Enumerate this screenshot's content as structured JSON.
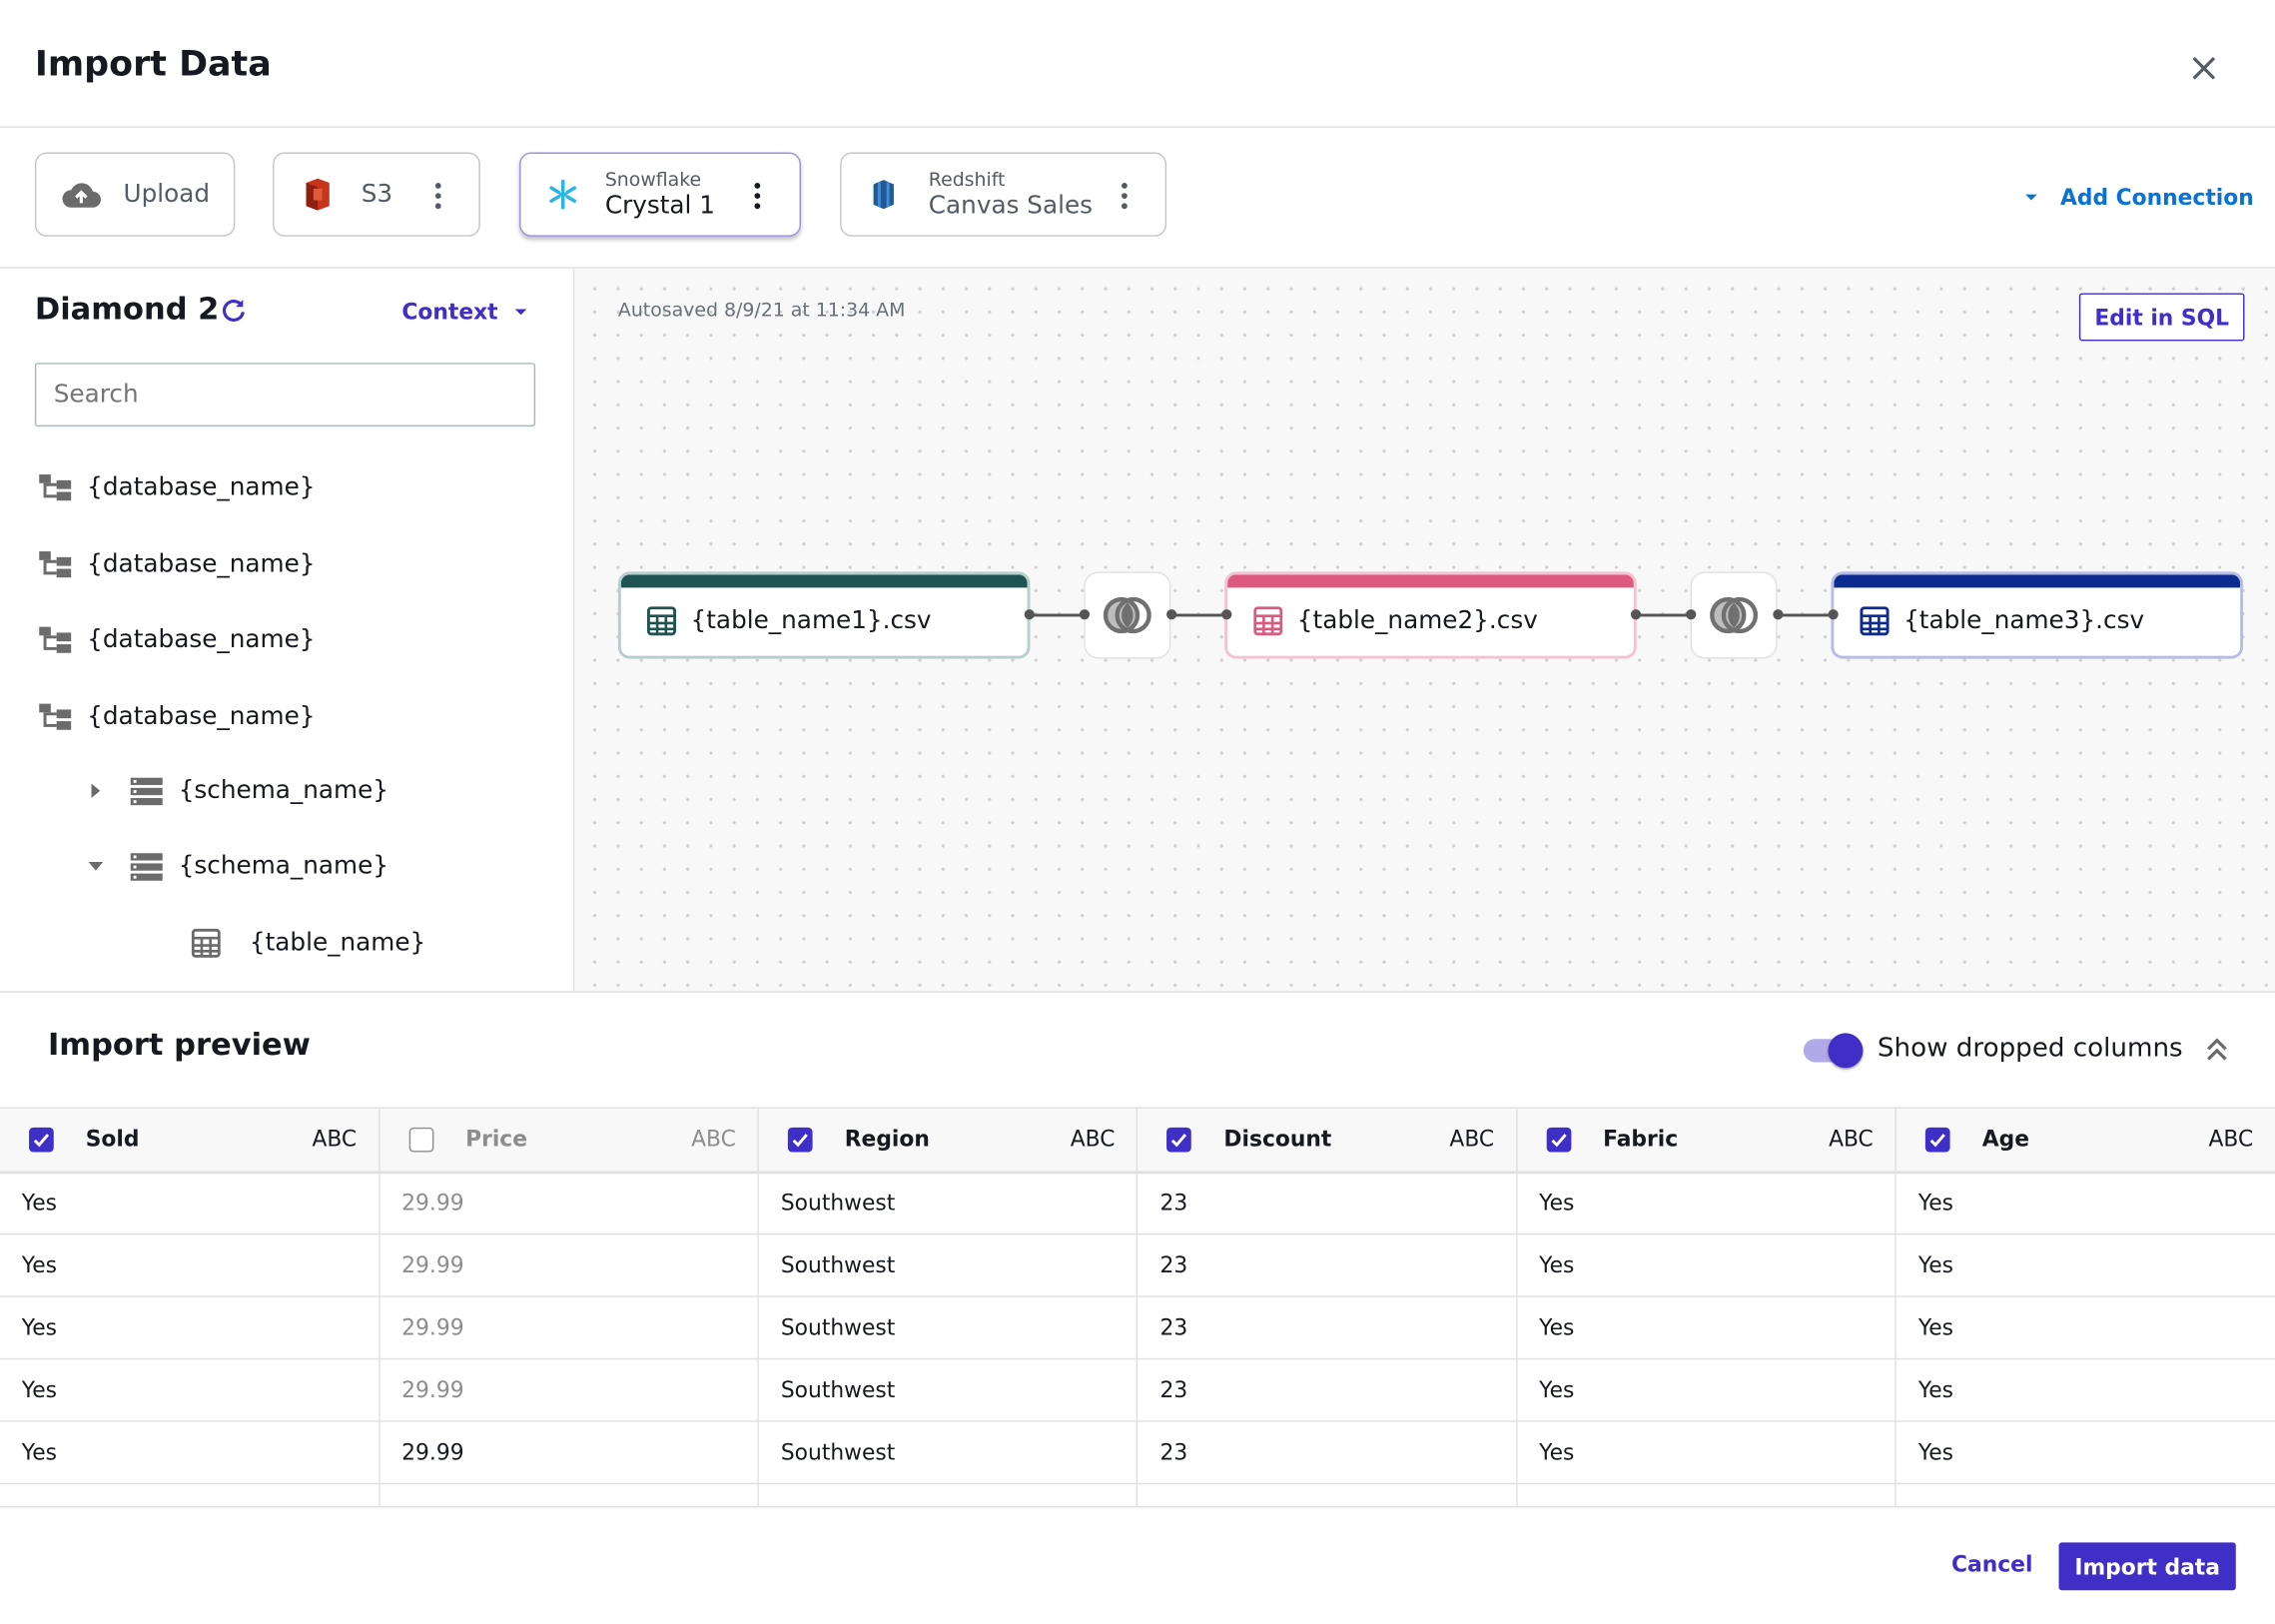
{
  "header": {
    "title": "Import Data",
    "close_icon": "close-icon"
  },
  "connections": {
    "items": [
      {
        "label": "Upload",
        "icon": "cloud-upload-icon"
      },
      {
        "label": "S3",
        "icon": "s3-icon"
      },
      {
        "type": "Snowflake",
        "label": "Crystal 1",
        "icon": "snowflake-icon",
        "selected": true
      },
      {
        "type": "Redshift",
        "label": "Canvas Sales",
        "icon": "redshift-icon"
      }
    ],
    "add_connection": "Add Connection"
  },
  "sidebar": {
    "title": "Diamond 2",
    "context_label": "Context",
    "search_placeholder": "Search",
    "tree": [
      {
        "label": "{database_name}",
        "type": "database"
      },
      {
        "label": "{database_name}",
        "type": "database"
      },
      {
        "label": "{database_name}",
        "type": "database"
      },
      {
        "label": "{database_name}",
        "type": "database"
      },
      {
        "label": "{schema_name}",
        "type": "schema",
        "expanded": false
      },
      {
        "label": "{schema_name}",
        "type": "schema",
        "expanded": true
      },
      {
        "label": "{table_name}",
        "type": "table"
      }
    ]
  },
  "canvas": {
    "autosaved": "Autosaved 8/9/21 at 11:34 AM",
    "edit_sql": "Edit in SQL",
    "nodes": [
      {
        "label": "{table_name1}.csv",
        "color": "#1f5452"
      },
      {
        "label": "{table_name2}.csv",
        "color": "#dc5a7f"
      },
      {
        "label": "{table_name3}.csv",
        "color": "#0c2b8f"
      }
    ]
  },
  "preview": {
    "title": "Import preview",
    "toggle_label": "Show dropped columns",
    "toggle_on": true,
    "columns": [
      {
        "name": "Sold",
        "type": "ABC",
        "checked": true
      },
      {
        "name": "Price",
        "type": "ABC",
        "checked": false
      },
      {
        "name": "Region",
        "type": "ABC",
        "checked": true
      },
      {
        "name": "Discount",
        "type": "ABC",
        "checked": true
      },
      {
        "name": "Fabric",
        "type": "ABC",
        "checked": true
      },
      {
        "name": "Age",
        "type": "ABC",
        "checked": true
      }
    ],
    "rows": [
      [
        "Yes",
        "29.99",
        "Southwest",
        "23",
        "Yes",
        "Yes"
      ],
      [
        "Yes",
        "29.99",
        "Southwest",
        "23",
        "Yes",
        "Yes"
      ],
      [
        "Yes",
        "29.99",
        "Southwest",
        "23",
        "Yes",
        "Yes"
      ],
      [
        "Yes",
        "29.99",
        "Southwest",
        "23",
        "Yes",
        "Yes"
      ],
      [
        "Yes",
        "29.99",
        "Southwest",
        "23",
        "Yes",
        "Yes"
      ]
    ]
  },
  "footer": {
    "cancel": "Cancel",
    "import": "Import data"
  },
  "colors": {
    "accent": "#3f2fc6",
    "link": "#0972d3"
  }
}
